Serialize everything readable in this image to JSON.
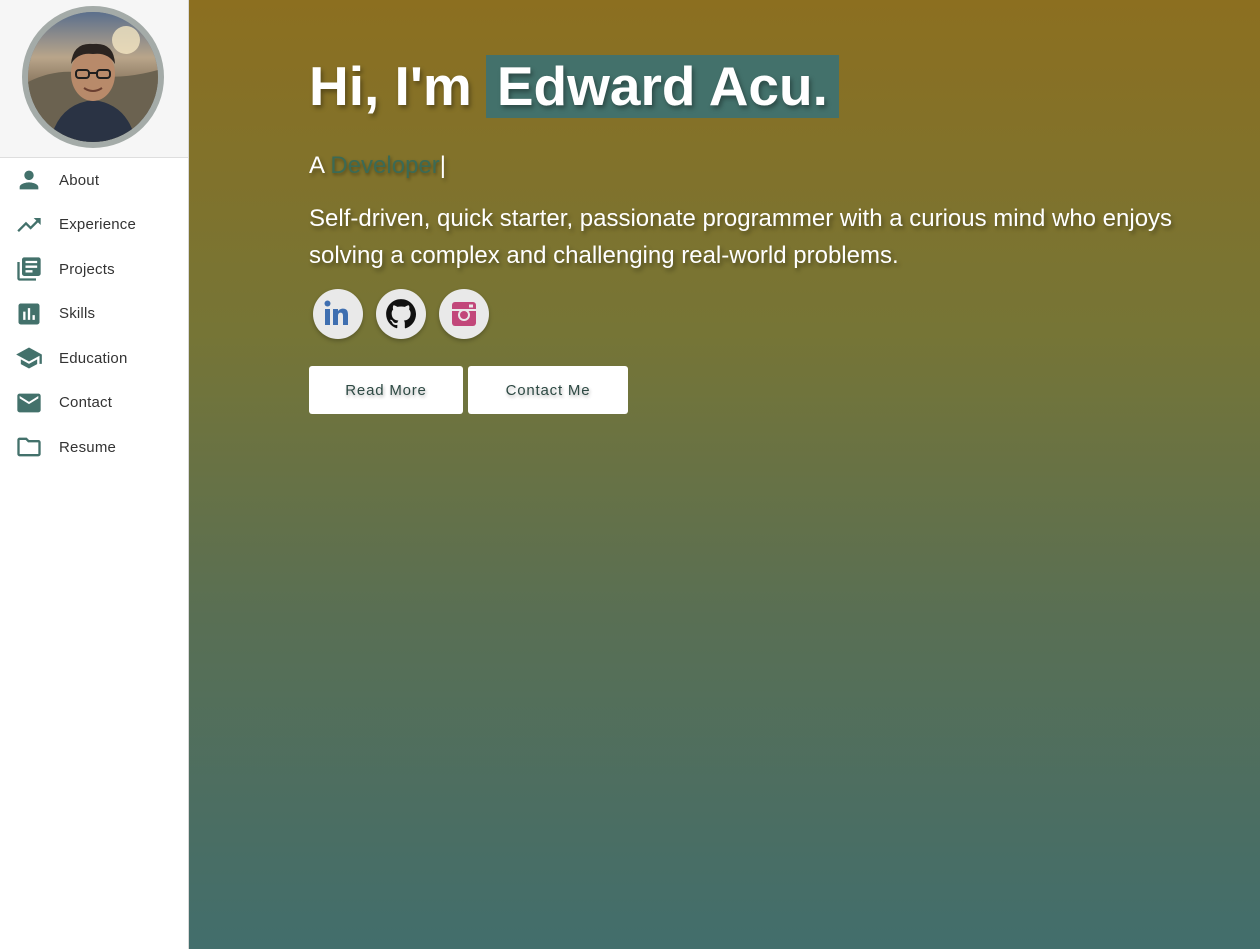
{
  "sidebar": {
    "items": [
      {
        "label": "About",
        "icon": "person-icon"
      },
      {
        "label": "Experience",
        "icon": "trending-up-icon"
      },
      {
        "label": "Projects",
        "icon": "library-books-icon"
      },
      {
        "label": "Skills",
        "icon": "bar-chart-icon"
      },
      {
        "label": "Education",
        "icon": "school-icon"
      },
      {
        "label": "Contact",
        "icon": "mail-icon"
      },
      {
        "label": "Resume",
        "icon": "folder-icon"
      }
    ]
  },
  "hero": {
    "greeting_prefix": "Hi, I'm",
    "name": "Edward Acu.",
    "tagline_prefix": "A",
    "role": "Developer",
    "cursor": "|",
    "description": "Self-driven, quick starter, passionate programmer with a curious mind who enjoys solving a complex and challenging real-world problems.",
    "socials": [
      {
        "icon": "linkedin-icon"
      },
      {
        "icon": "github-icon"
      },
      {
        "icon": "instagram-icon"
      }
    ],
    "read_more_label": "Read More",
    "contact_me_label": "Contact Me"
  },
  "colors": {
    "accent": "#43716b",
    "gradient_top": "#8c6f20",
    "gradient_bottom": "#426e6c",
    "avatar_border": "#a4aba8"
  }
}
